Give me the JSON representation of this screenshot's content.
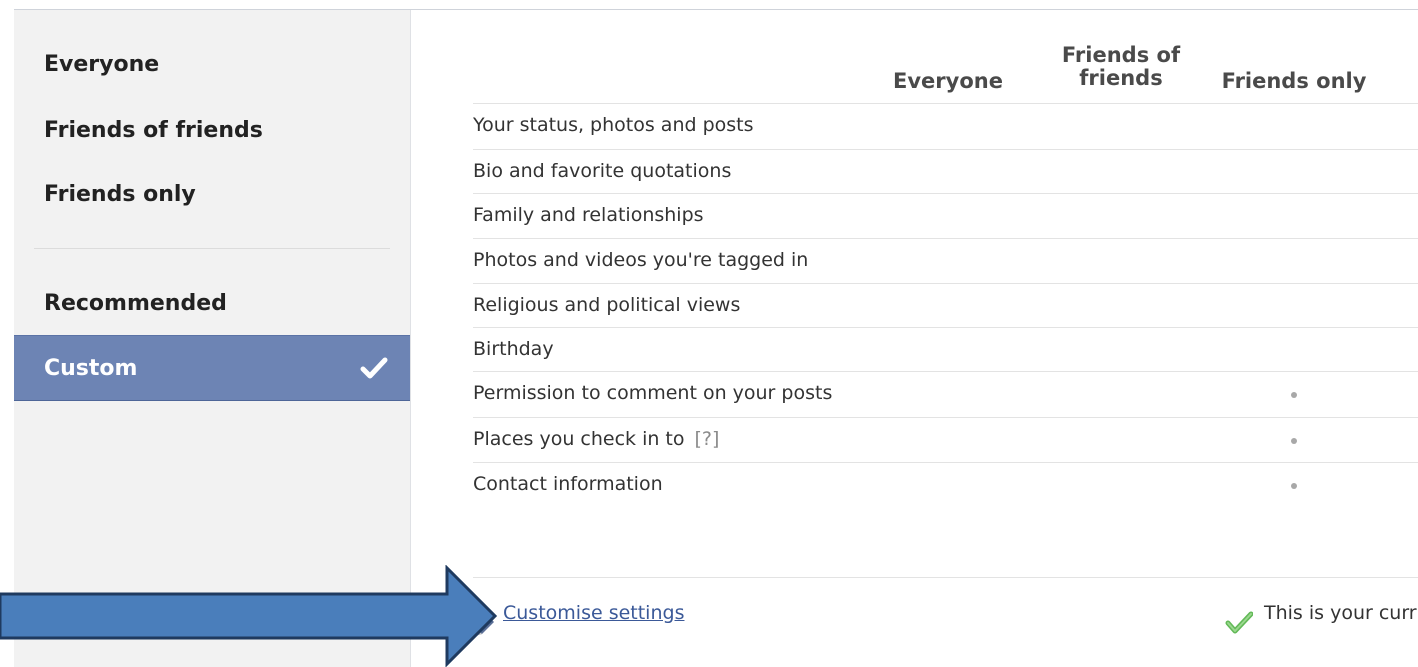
{
  "sidebar": {
    "items": [
      {
        "label": "Everyone"
      },
      {
        "label": "Friends of friends"
      },
      {
        "label": "Friends only"
      },
      {
        "label": "Recommended"
      },
      {
        "label": "Custom"
      }
    ],
    "selected": "Custom"
  },
  "table": {
    "headers": {
      "everyone": "Everyone",
      "friends_of_friends_line1": "Friends of",
      "friends_of_friends_line2": "friends",
      "friends_only": "Friends only"
    },
    "rows": [
      {
        "label": "Your status, photos and posts",
        "setting": ""
      },
      {
        "label": "Bio and favorite quotations",
        "setting": ""
      },
      {
        "label": "Family and relationships",
        "setting": ""
      },
      {
        "label": "Photos and videos you're tagged in",
        "setting": ""
      },
      {
        "label": "Religious and political views",
        "setting": ""
      },
      {
        "label": "Birthday",
        "setting": ""
      },
      {
        "label": "Permission to comment on your posts",
        "setting": "Friends only"
      },
      {
        "label": "Places you check in to",
        "help": "[?]",
        "setting": "Friends only"
      },
      {
        "label": "Contact information",
        "setting": "Friends only"
      }
    ]
  },
  "footer": {
    "customise_label": "Customise settings",
    "current_text": "This is your curr"
  },
  "colors": {
    "selected_bg": "#6d84b4",
    "link": "#3b5998",
    "arrow_fill": "#4a7ebb",
    "arrow_stroke": "#1f3a5f"
  },
  "icons": [
    "checkmark-icon",
    "pencil-icon",
    "green-check-icon",
    "arrow-annotation"
  ]
}
